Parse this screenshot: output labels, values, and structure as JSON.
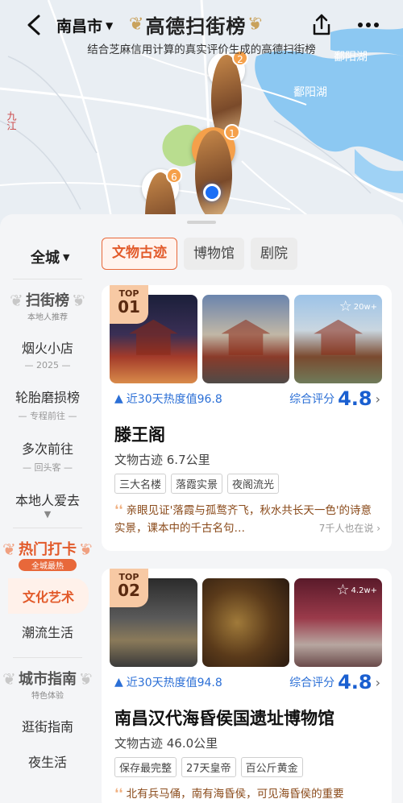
{
  "header": {
    "city": "南昌市",
    "title": "高德扫街榜",
    "subtitle": "结合芝麻信用计算的真实评价生成的高德扫街榜"
  },
  "map": {
    "lake_labels": [
      "鄱阳湖",
      "鄱阳湖"
    ],
    "side_label": "九江",
    "pins": [
      {
        "num": "1"
      },
      {
        "num": "2"
      },
      {
        "num": "6"
      }
    ],
    "colors": {
      "water": "#8cc8f2",
      "land": "#e9eef3",
      "park": "#b9dd8f",
      "accent": "#f5a04a"
    }
  },
  "filter": {
    "scope": "全城",
    "tabs": [
      "文物古迹",
      "博物馆",
      "剧院"
    ]
  },
  "sidebar": {
    "sections": [
      {
        "badge": {
          "main": "扫街榜",
          "sub": "本地人推荐"
        },
        "items": [
          {
            "label": "烟火小店",
            "note": "2025"
          },
          {
            "label": "轮胎磨损榜",
            "note": "专程前往"
          },
          {
            "label": "多次前往",
            "note": "回头客"
          },
          {
            "label": "本地人爱去",
            "note": ""
          }
        ]
      },
      {
        "badge": {
          "main": "热门打卡",
          "sub": "全城最热"
        },
        "items": [
          {
            "label": "文化艺术",
            "note": ""
          },
          {
            "label": "潮流生活",
            "note": ""
          }
        ]
      },
      {
        "badge": {
          "main": "城市指南",
          "sub": "特色体验"
        },
        "items": [
          {
            "label": "逛街指南",
            "note": ""
          },
          {
            "label": "夜生活",
            "note": ""
          }
        ]
      }
    ]
  },
  "cards": [
    {
      "rank_top": "TOP",
      "rank_num": "01",
      "fav_count": "20w+",
      "heat": "近30天热度值96.8",
      "rating_label": "综合评分",
      "rating": "4.8",
      "name": "滕王阁",
      "category_distance": "文物古迹 6.7公里",
      "tags": [
        "三大名楼",
        "落霞实景",
        "夜阁流光"
      ],
      "quote": "亲眼见证'落霞与孤鹜齐飞，秋水共长天一色'的诗意实景，课本中的千古名句…",
      "quote_count": "7千人也在说"
    },
    {
      "rank_top": "TOP",
      "rank_num": "02",
      "fav_count": "4.2w+",
      "heat": "近30天热度值94.8",
      "rating_label": "综合评分",
      "rating": "4.8",
      "name": "南昌汉代海昏侯国遗址博物馆",
      "category_distance": "文物古迹 46.0公里",
      "tags": [
        "保存最完整",
        "27天皇帝",
        "百公斤黄金"
      ],
      "quote": "北有兵马俑，南有海昏侯，可见海昏侯的重要",
      "quote_count": ""
    }
  ]
}
